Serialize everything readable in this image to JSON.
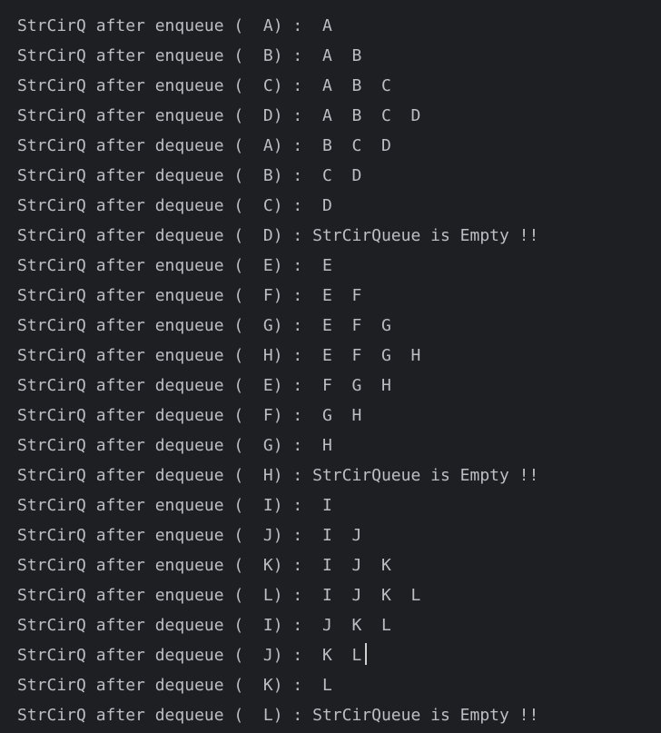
{
  "console": {
    "lines": [
      "StrCirQ after enqueue (  A) :  A",
      "StrCirQ after enqueue (  B) :  A  B",
      "StrCirQ after enqueue (  C) :  A  B  C",
      "StrCirQ after enqueue (  D) :  A  B  C  D",
      "StrCirQ after dequeue (  A) :  B  C  D",
      "StrCirQ after dequeue (  B) :  C  D",
      "StrCirQ after dequeue (  C) :  D",
      "StrCirQ after dequeue (  D) : StrCirQueue is Empty !!",
      "StrCirQ after enqueue (  E) :  E",
      "StrCirQ after enqueue (  F) :  E  F",
      "StrCirQ after enqueue (  G) :  E  F  G",
      "StrCirQ after enqueue (  H) :  E  F  G  H",
      "StrCirQ after dequeue (  E) :  F  G  H",
      "StrCirQ after dequeue (  F) :  G  H",
      "StrCirQ after dequeue (  G) :  H",
      "StrCirQ after dequeue (  H) : StrCirQueue is Empty !!",
      "StrCirQ after enqueue (  I) :  I",
      "StrCirQ after enqueue (  J) :  I  J",
      "StrCirQ after enqueue (  K) :  I  J  K",
      "StrCirQ after enqueue (  L) :  I  J  K  L",
      "StrCirQ after dequeue (  I) :  J  K  L",
      "StrCirQ after dequeue (  J) :  K  L",
      "StrCirQ after dequeue (  K) :  L",
      "StrCirQ after dequeue (  L) : StrCirQueue is Empty !!"
    ],
    "caret_line": 21
  },
  "colors": {
    "background": "#1e1f22",
    "text": "#bcbec4",
    "caret": "#d0d0d0"
  }
}
